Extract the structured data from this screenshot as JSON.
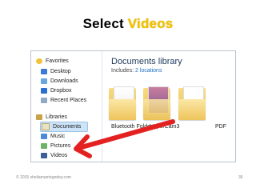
{
  "slide": {
    "title_part1": "Select",
    "title_part2": "Videos",
    "accent_color": "#f2c300"
  },
  "explorer": {
    "nav": {
      "favorites_header": "Favorites",
      "favorites": [
        "Desktop",
        "Downloads",
        "Dropbox",
        "Recent Places"
      ],
      "libraries_header": "Libraries",
      "libraries": [
        "Documents",
        "Music",
        "Pictures",
        "Videos"
      ]
    },
    "library_title": "Documents library",
    "includes_label": "Includes:",
    "includes_link": "2 locations",
    "folders": [
      "Bluetooth Folder",
      "HyperCam3",
      "PDF"
    ]
  },
  "footer": {
    "copyright": "© 2015 sheilamarriegodoy.com",
    "page_number": "36"
  }
}
